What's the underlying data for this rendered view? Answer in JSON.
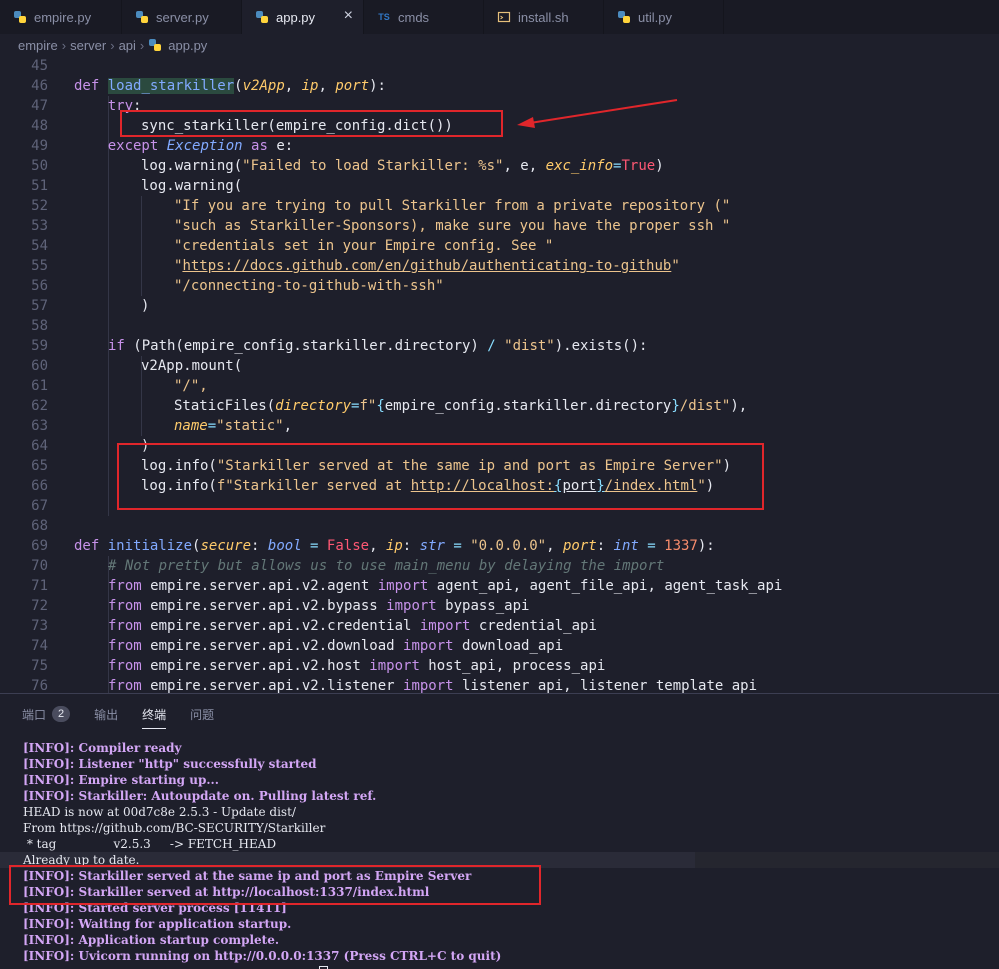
{
  "tabs": [
    {
      "label": "empire.py",
      "icon": "python-icon"
    },
    {
      "label": "server.py",
      "icon": "python-icon"
    },
    {
      "label": "app.py",
      "icon": "python-icon",
      "active": true
    },
    {
      "label": "cmds",
      "icon": "typescript-icon",
      "icon_text": "TS"
    },
    {
      "label": "install.sh",
      "icon": "shell-icon"
    },
    {
      "label": "util.py",
      "icon": "python-icon"
    }
  ],
  "breadcrumb": {
    "items": [
      "empire",
      "server",
      "api",
      "app.py"
    ]
  },
  "line_numbers": [
    "45",
    "46",
    "47",
    "48",
    "49",
    "50",
    "51",
    "52",
    "53",
    "54",
    "55",
    "56",
    "57",
    "58",
    "59",
    "60",
    "61",
    "62",
    "63",
    "64",
    "65",
    "66",
    "67",
    "68",
    "69",
    "70",
    "71",
    "72",
    "73",
    "74",
    "75",
    "76"
  ],
  "code": {
    "l46_def": "def",
    "l46_fn": "load_starkiller",
    "l46_a1": "v2App",
    "l46_a2": "ip",
    "l46_a3": "port",
    "l47_try": "try",
    "l48": "sync_starkiller(empire_config.dict())",
    "l49_except": "except",
    "l49_cls": "Exception",
    "l49_as": "as",
    "l49_e": "e:",
    "l50_a": "log.warning(",
    "l50_s": "\"Failed to load Starkiller: %s\"",
    "l50_b": ", e, ",
    "l50_k": "exc_info",
    "l50_eq": "=",
    "l50_v": "True",
    "l50_c": ")",
    "l51": "log.warning(",
    "l52": "\"If you are trying to pull Starkiller from a private repository (\"",
    "l53": "\"such as Starkiller-Sponsors), make sure you have the proper ssh \"",
    "l54": "\"credentials set in your Empire config. See \"",
    "l55_q": "\"",
    "l55_u": "https://docs.github.com/en/github/authenticating-to-github",
    "l55_q2": "\"",
    "l56": "\"/connecting-to-github-with-ssh\"",
    "l57": ")",
    "l59_if": "if",
    "l59_a": " (Path(empire_config.starkiller.directory) ",
    "l59_op": "/",
    "l59_s": " \"dist\"",
    "l59_b": ").exists():",
    "l60": "v2App.mount(",
    "l61": "\"/\",",
    "l62_a": "StaticFiles(",
    "l62_k": "directory",
    "l62_eq": "=",
    "l62_f": "f\"",
    "l62_b1": "{",
    "l62_v": "empire_config.starkiller.directory",
    "l62_b2": "}",
    "l62_s": "/dist\"",
    "l62_c": "),",
    "l63_k": "name",
    "l63_eq": "=",
    "l63_s": "\"static\"",
    "l63_c": ",",
    "l64": ")",
    "l65_a": "log.info(",
    "l65_s": "\"Starkiller served at the same ip and port as Empire Server\"",
    "l65_c": ")",
    "l66_a": "log.info(",
    "l66_f": "f\"Starkiller served at ",
    "l66_u": "http://localhost:",
    "l66_b1": "{",
    "l66_v": "port",
    "l66_b2": "}",
    "l66_u2": "/index.html",
    "l66_q": "\"",
    "l66_c": ")",
    "l69_def": "def",
    "l69_fn": "initialize",
    "l69_p1": "secure",
    "l69_t1": "bool",
    "l69_eq1": " = ",
    "l69_v1": "False",
    "l69_p2": "ip",
    "l69_t2": "str",
    "l69_eq2": " = ",
    "l69_v2": "\"0.0.0.0\"",
    "l69_p3": "port",
    "l69_t3": "int",
    "l69_eq3": " = ",
    "l69_v3": "1337",
    "l69_end": "):",
    "l70": "# Not pretty but allows us to use main_menu by delaying the import",
    "imports": [
      {
        "from": "from",
        "mod": " empire.server.api.v2.agent ",
        "imp": "import",
        "names": " agent_api, agent_file_api, agent_task_api"
      },
      {
        "from": "from",
        "mod": " empire.server.api.v2.bypass ",
        "imp": "import",
        "names": " bypass_api"
      },
      {
        "from": "from",
        "mod": " empire.server.api.v2.credential ",
        "imp": "import",
        "names": " credential_api"
      },
      {
        "from": "from",
        "mod": " empire.server.api.v2.download ",
        "imp": "import",
        "names": " download_api"
      },
      {
        "from": "from",
        "mod": " empire.server.api.v2.host ",
        "imp": "import",
        "names": " host_api, process_api"
      },
      {
        "from": "from",
        "mod": " empire.server.api.v2.listener ",
        "imp": "import",
        "names": " listener_api, listener_template_api"
      }
    ]
  },
  "panel_tabs": [
    {
      "label": "端口",
      "badge": "2"
    },
    {
      "label": "输出"
    },
    {
      "label": "终端",
      "active": true
    },
    {
      "label": "问题"
    }
  ],
  "terminal_lines": [
    {
      "tag": "[INFO]",
      "text": ": Compiler ready"
    },
    {
      "tag": "[INFO]",
      "text": ": Listener \"http\" successfully started"
    },
    {
      "tag": "[INFO]",
      "text": ": Empire starting up..."
    },
    {
      "tag": "[INFO]",
      "text": ": Starkiller: Autoupdate on. Pulling latest ref."
    },
    {
      "plain": "HEAD is now at 00d7c8e 2.5.3 - Update dist/"
    },
    {
      "plain": "From https://github.com/BC-SECURITY/Starkiller"
    },
    {
      "plain": " * tag               v2.5.3     -> FETCH_HEAD"
    },
    {
      "plain": "Already up to date."
    },
    {
      "tag": "[INFO]",
      "text": ": Starkiller served at the same ip and port as Empire Server"
    },
    {
      "tag": "[INFO]",
      "text": ": Starkiller served at http://localhost:1337/index.html"
    },
    {
      "tag": "[INFO]",
      "text": ": Started server process [11411]"
    },
    {
      "tag": "[INFO]",
      "text": ": Waiting for application startup."
    },
    {
      "tag": "[INFO]",
      "text": ": Application startup complete."
    },
    {
      "tag": "[INFO]",
      "text": ": Uvicorn running on http://0.0.0.0:1337 (Press CTRL+C to quit)"
    },
    {
      "plain": "─────────────────────────────────────────",
      "cursor": true
    }
  ],
  "colors": {
    "annotation": "#e0262b",
    "info_tag": "#d3a6f5",
    "background": "#1e1f2b"
  }
}
